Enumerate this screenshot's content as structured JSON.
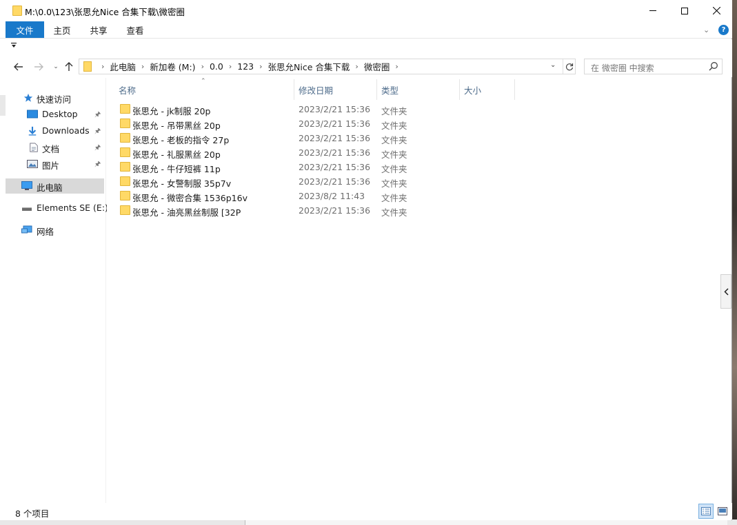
{
  "window": {
    "title": "M:\\0.0\\123\\张思允Nice 合集下载\\微密圈"
  },
  "ribbon": {
    "tabs": [
      {
        "label": "文件"
      },
      {
        "label": "主页"
      },
      {
        "label": "共享"
      },
      {
        "label": "查看"
      }
    ]
  },
  "address": {
    "crumbs": [
      "此电脑",
      "新加卷 (M:)",
      "0.0",
      "123",
      "张思允Nice 合集下载",
      "微密圈"
    ]
  },
  "search": {
    "placeholder": "在 微密圈 中搜索"
  },
  "navpane": {
    "quick_access": "快速访问",
    "items": [
      {
        "label": "Desktop",
        "icon": "desktop-icon",
        "pinned": true
      },
      {
        "label": "Downloads",
        "icon": "downloads-icon",
        "pinned": true
      },
      {
        "label": "文档",
        "icon": "documents-icon",
        "pinned": true
      },
      {
        "label": "图片",
        "icon": "pictures-icon",
        "pinned": true
      }
    ],
    "this_pc": "此电脑",
    "drive": "Elements SE (E:)",
    "network": "网络"
  },
  "columns": {
    "name": "名称",
    "date": "修改日期",
    "type": "类型",
    "size": "大小"
  },
  "files": [
    {
      "name": "张思允 - jk制服 20p",
      "date": "2023/2/21 15:36",
      "type": "文件夹"
    },
    {
      "name": "张思允 - 吊带黑丝 20p",
      "date": "2023/2/21 15:36",
      "type": "文件夹"
    },
    {
      "name": "张思允 - 老板的指令 27p",
      "date": "2023/2/21 15:36",
      "type": "文件夹"
    },
    {
      "name": "张思允 - 礼服黑丝 20p",
      "date": "2023/2/21 15:36",
      "type": "文件夹"
    },
    {
      "name": "张思允 - 牛仔短裤 11p",
      "date": "2023/2/21 15:36",
      "type": "文件夹"
    },
    {
      "name": "张思允 - 女警制服 35p7v",
      "date": "2023/2/21 15:36",
      "type": "文件夹"
    },
    {
      "name": "张思允 - 微密合集 1536p16v",
      "date": "2023/8/2 11:43",
      "type": "文件夹"
    },
    {
      "name": "张思允 - 油亮黑丝制服 [32P",
      "date": "2023/2/21 15:36",
      "type": "文件夹"
    }
  ],
  "status": {
    "item_count": "8 个项目"
  },
  "colors": {
    "accent": "#1979ca",
    "folder": "#ffd966",
    "header_text": "#4d6b8a",
    "selected_nav": "#d9d9d9"
  }
}
